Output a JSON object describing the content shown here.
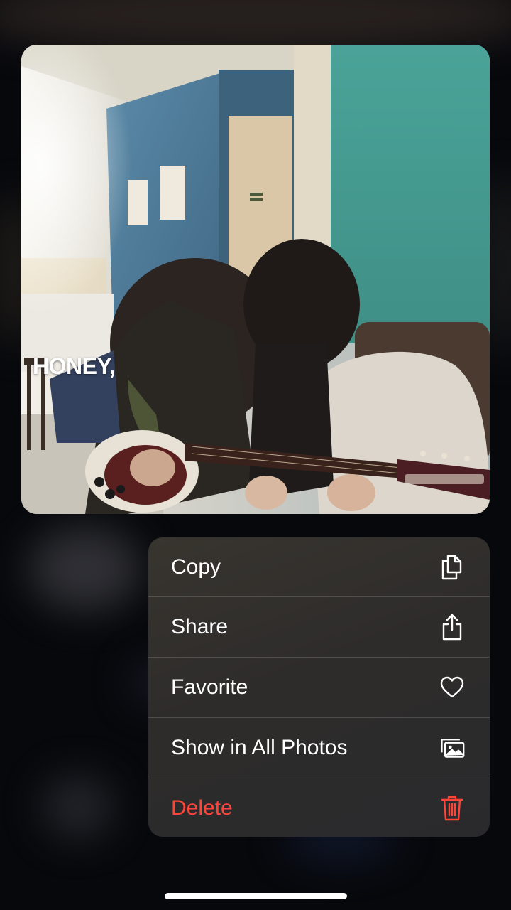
{
  "photo": {
    "caption": "HONEY,"
  },
  "menu": {
    "items": [
      {
        "label": "Copy",
        "icon": "copy-icon",
        "destructive": false
      },
      {
        "label": "Share",
        "icon": "share-icon",
        "destructive": false
      },
      {
        "label": "Favorite",
        "icon": "heart-icon",
        "destructive": false
      },
      {
        "label": "Show in All Photos",
        "icon": "photos-icon",
        "destructive": false
      },
      {
        "label": "Delete",
        "icon": "trash-icon",
        "destructive": true
      }
    ]
  },
  "colors": {
    "destructive": "#ff453a",
    "menu_background": "#2e2c2b",
    "label": "#ffffff"
  }
}
